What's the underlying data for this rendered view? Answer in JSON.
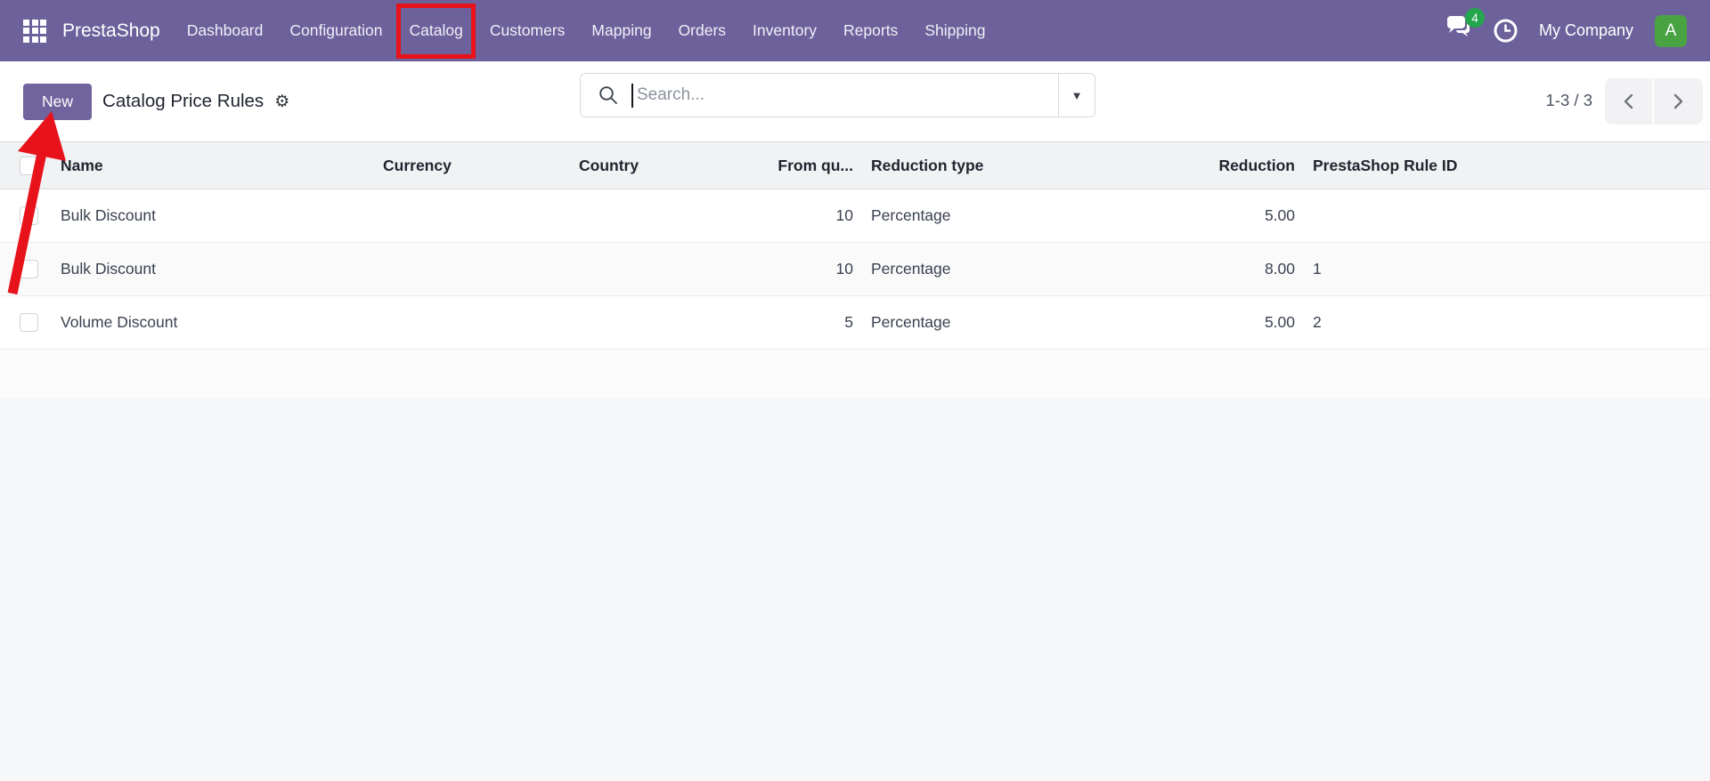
{
  "nav": {
    "brand": "PrestaShop",
    "items": [
      {
        "label": "Dashboard"
      },
      {
        "label": "Configuration"
      },
      {
        "label": "Catalog",
        "highlighted": true
      },
      {
        "label": "Customers"
      },
      {
        "label": "Mapping"
      },
      {
        "label": "Orders"
      },
      {
        "label": "Inventory"
      },
      {
        "label": "Reports"
      },
      {
        "label": "Shipping"
      }
    ],
    "messages_badge": "4",
    "company_name": "My Company",
    "avatar_initial": "A"
  },
  "control_bar": {
    "new_button_label": "New",
    "page_title": "Catalog Price Rules",
    "search_placeholder": "Search...",
    "pager_range": "1-3 / 3"
  },
  "table": {
    "columns": {
      "name": "Name",
      "currency": "Currency",
      "country": "Country",
      "from_qty": "From qu...",
      "reduction_type": "Reduction type",
      "reduction": "Reduction",
      "rule_id": "PrestaShop Rule ID"
    },
    "rows": [
      {
        "name": "Bulk Discount",
        "currency": "",
        "country": "",
        "from_qty": "10",
        "reduction_type": "Percentage",
        "reduction": "5.00",
        "rule_id": ""
      },
      {
        "name": "Bulk Discount",
        "currency": "",
        "country": "",
        "from_qty": "10",
        "reduction_type": "Percentage",
        "reduction": "8.00",
        "rule_id": "1"
      },
      {
        "name": "Volume Discount",
        "currency": "",
        "country": "",
        "from_qty": "5",
        "reduction_type": "Percentage",
        "reduction": "5.00",
        "rule_id": "2"
      }
    ]
  },
  "icons": {
    "gear_glyph": "⚙",
    "dropdown_glyph": "▼"
  },
  "colors": {
    "navbar_purple": "#6d619b",
    "primary_button_purple": "#71639e",
    "annotation_red": "#e8121a",
    "badge_green": "#23a64e",
    "avatar_green": "#49a342"
  },
  "annotations": {
    "highlight_box_on": "Catalog",
    "arrow_points_to": "New"
  }
}
